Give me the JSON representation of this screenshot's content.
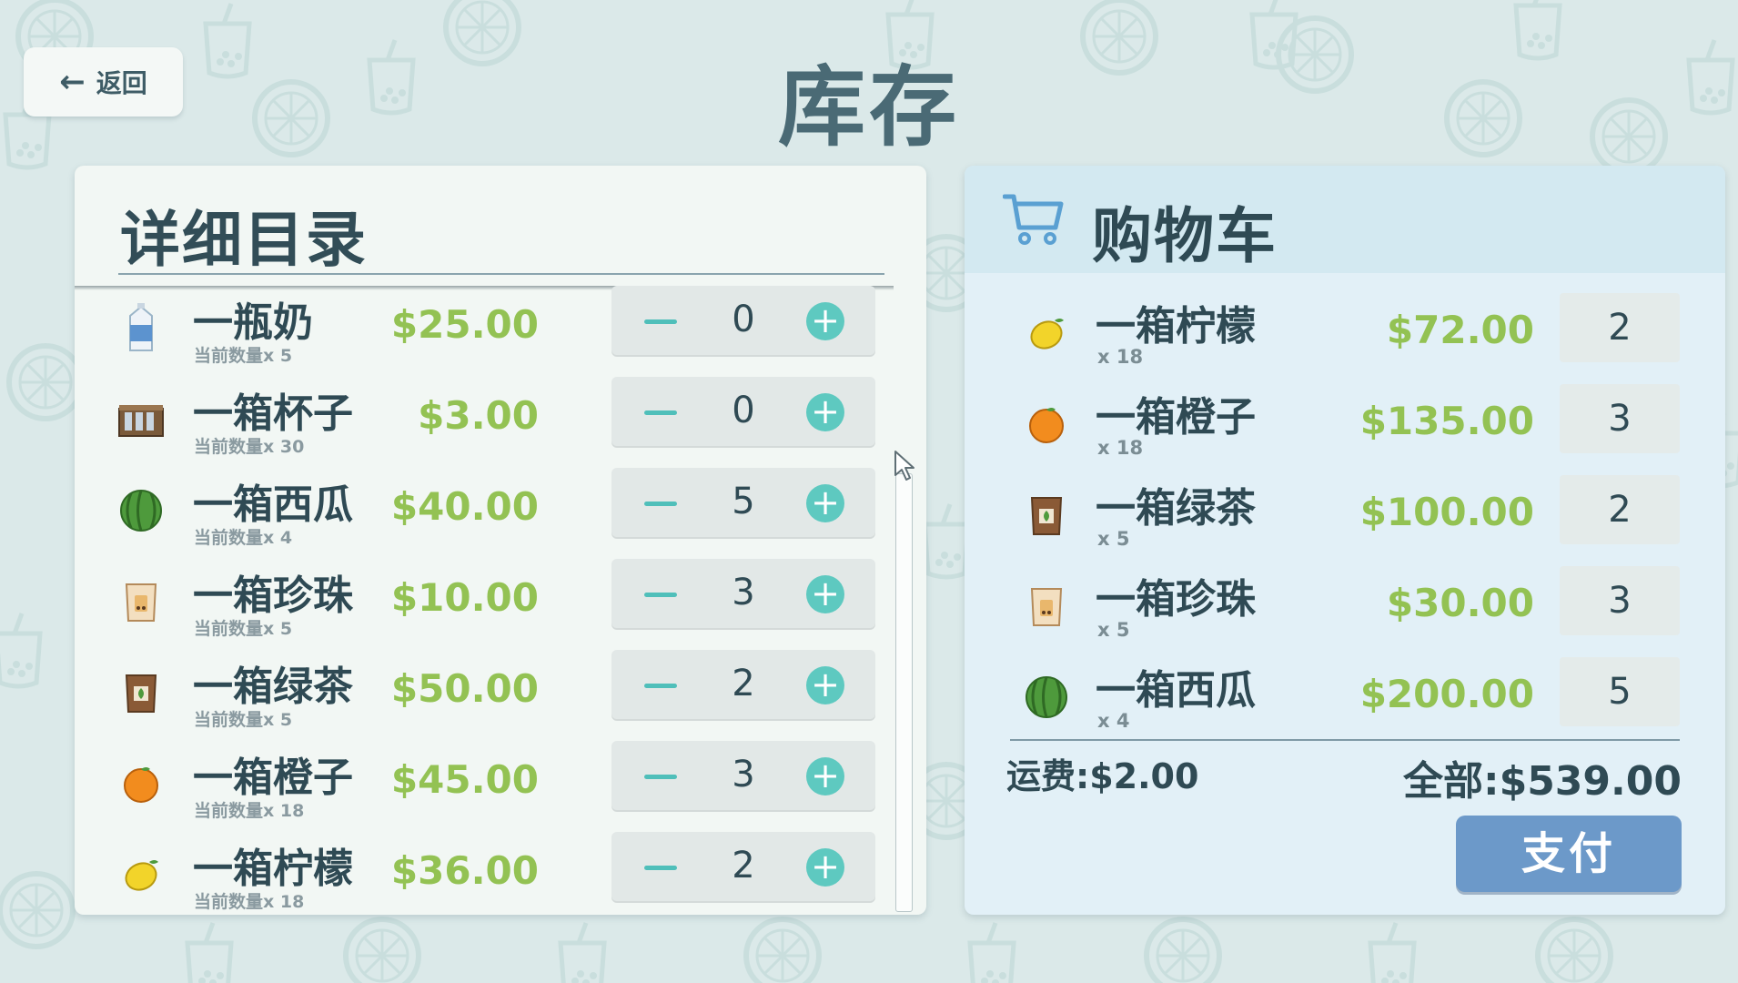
{
  "page": {
    "title": "库存",
    "back_label": "返回"
  },
  "catalog": {
    "title": "详细目录",
    "items": [
      {
        "name": "一瓶奶",
        "qty_label": "当前数量x 5",
        "price": "$25.00",
        "count": "0",
        "icon": "milk-carton-icon"
      },
      {
        "name": "一箱杯子",
        "qty_label": "当前数量x 30",
        "price": "$3.00",
        "count": "0",
        "icon": "cups-box-icon"
      },
      {
        "name": "一箱西瓜",
        "qty_label": "当前数量x 4",
        "price": "$40.00",
        "count": "5",
        "icon": "watermelon-icon"
      },
      {
        "name": "一箱珍珠",
        "qty_label": "当前数量x 5",
        "price": "$10.00",
        "count": "3",
        "icon": "pearl-bag-icon"
      },
      {
        "name": "一箱绿茶",
        "qty_label": "当前数量x 5",
        "price": "$50.00",
        "count": "2",
        "icon": "green-tea-bag-icon"
      },
      {
        "name": "一箱橙子",
        "qty_label": "当前数量x 18",
        "price": "$45.00",
        "count": "3",
        "icon": "orange-icon"
      },
      {
        "name": "一箱柠檬",
        "qty_label": "当前数量x 18",
        "price": "$36.00",
        "count": "2",
        "icon": "lemon-icon"
      }
    ]
  },
  "cart": {
    "title": "购物车",
    "items": [
      {
        "name": "一箱柠檬",
        "count_label": "x 18",
        "price": "$72.00",
        "qty": "2",
        "icon": "lemon-icon"
      },
      {
        "name": "一箱橙子",
        "count_label": "x 18",
        "price": "$135.00",
        "qty": "3",
        "icon": "orange-icon"
      },
      {
        "name": "一箱绿茶",
        "count_label": "x 5",
        "price": "$100.00",
        "qty": "2",
        "icon": "green-tea-bag-icon"
      },
      {
        "name": "一箱珍珠",
        "count_label": "x 5",
        "price": "$30.00",
        "qty": "3",
        "icon": "pearl-bag-icon"
      },
      {
        "name": "一箱西瓜",
        "count_label": "x 4",
        "price": "$200.00",
        "qty": "5",
        "icon": "watermelon-icon"
      }
    ],
    "shipping": "运费:$2.00",
    "total": "全部:$539.00",
    "pay_label": "支付"
  },
  "colors": {
    "price_green": "#93c253",
    "pay_blue": "#6c99c9",
    "plus_teal": "#5ec9c0",
    "background": "#dbe9e9"
  }
}
